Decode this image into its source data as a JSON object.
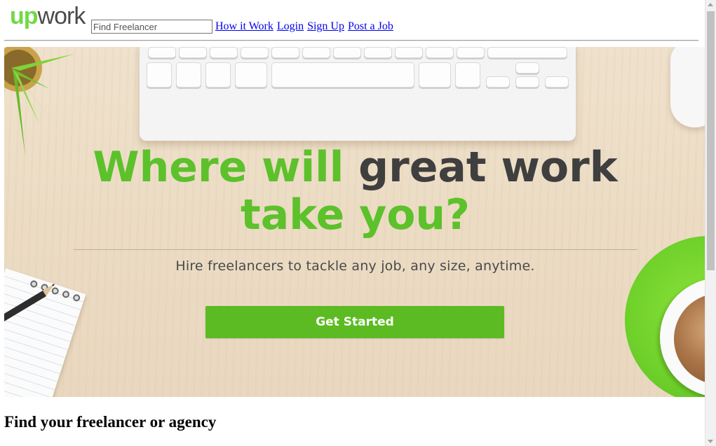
{
  "header": {
    "logo": {
      "up": "up",
      "work": "work"
    },
    "search": {
      "placeholder": "Find Freelancer",
      "value": ""
    },
    "nav": [
      {
        "label": "How it Work"
      },
      {
        "label": "Login"
      },
      {
        "label": "Sign Up"
      },
      {
        "label": "Post a Job"
      }
    ]
  },
  "hero": {
    "headline_green_1": "Where will",
    "headline_dark": "great work",
    "headline_green_2": "take you?",
    "subline": "Hire freelancers to tackle any job, any size, anytime.",
    "cta_label": "Get Started"
  },
  "main": {
    "section_title": "Find your freelancer or agency"
  },
  "colors": {
    "brand_green": "#5cc12b",
    "button_green": "#5cbb22",
    "dark_text": "#3f3f3f",
    "link": "#0000ee"
  },
  "icons": {
    "logo": "upwork-logo-icon"
  }
}
